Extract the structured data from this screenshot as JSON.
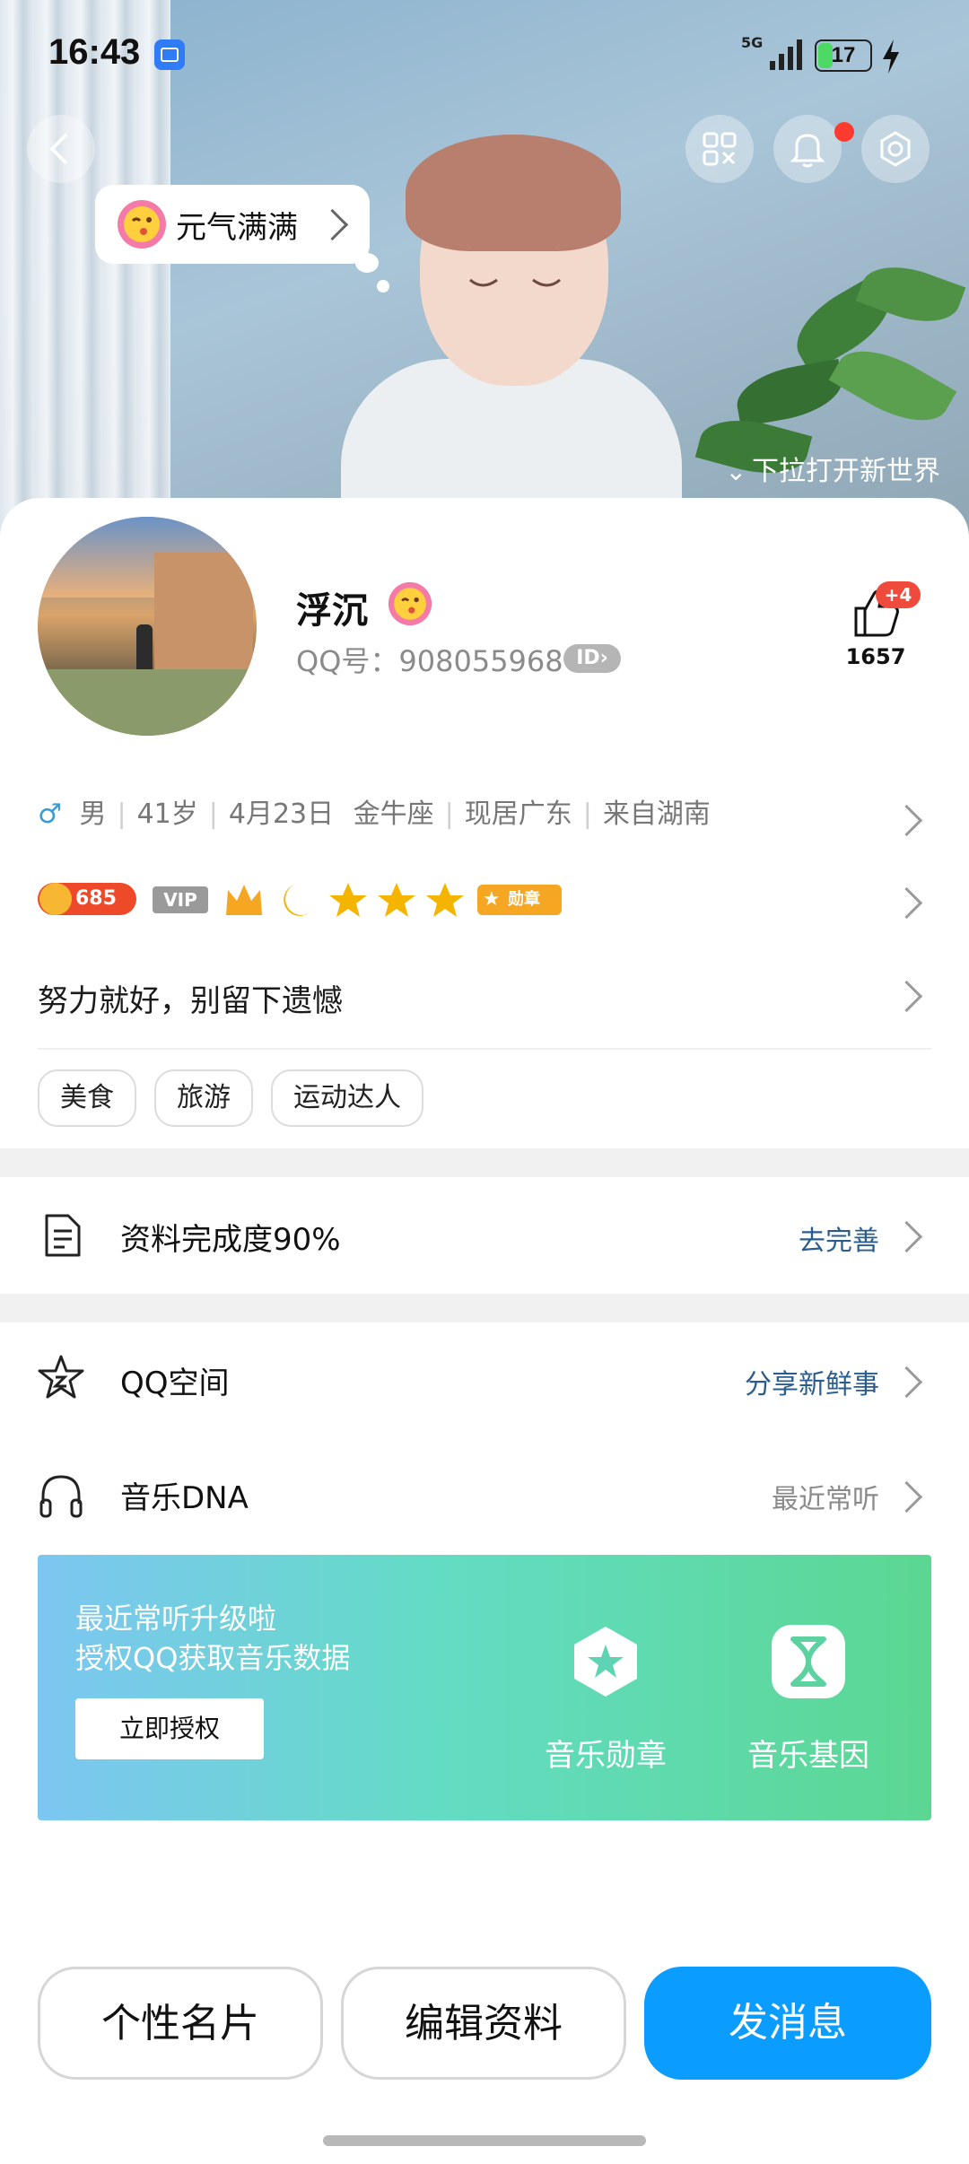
{
  "status_bar": {
    "time": "16:43",
    "network": "5G",
    "battery": "17"
  },
  "header": {
    "mood_label": "元气满满",
    "pull_hint": "下拉打开新世界",
    "notification_dot_color": "#ff3b30"
  },
  "profile": {
    "name": "浮沉",
    "qq_label": "QQ号：",
    "qq_number": "908055968",
    "id_badge": "ID",
    "likes": "1657",
    "likes_increment": "+4"
  },
  "info": {
    "gender": "男",
    "age": "41岁",
    "birthday": "4月23日",
    "zodiac": "金牛座",
    "location": "现居广东",
    "hometown": "来自湖南"
  },
  "badges": {
    "coin_level": "685",
    "vip": "VIP",
    "medal": "勋章"
  },
  "signature": "努力就好，别留下遗憾",
  "tags": [
    "美食",
    "旅游",
    "运动达人"
  ],
  "completion": {
    "label": "资料完成度90%",
    "action": "去完善"
  },
  "rows": {
    "qzone": {
      "label": "QQ空间",
      "action": "分享新鲜事"
    },
    "music": {
      "label": "音乐DNA",
      "action": "最近常听"
    }
  },
  "music_card": {
    "line1": "最近常听升级啦",
    "line2": "授权QQ获取音乐数据",
    "authorize": "立即授权",
    "medal_label": "音乐勋章",
    "gene_label": "音乐基因"
  },
  "bottom": {
    "card_button": "个性名片",
    "edit_button": "编辑资料",
    "message_button": "发消息"
  },
  "colors": {
    "accent_blue": "#0a9cff",
    "link_blue": "#2a5d8f",
    "music_gradient_start": "#7dc6f2",
    "music_gradient_end": "#5bd792"
  }
}
